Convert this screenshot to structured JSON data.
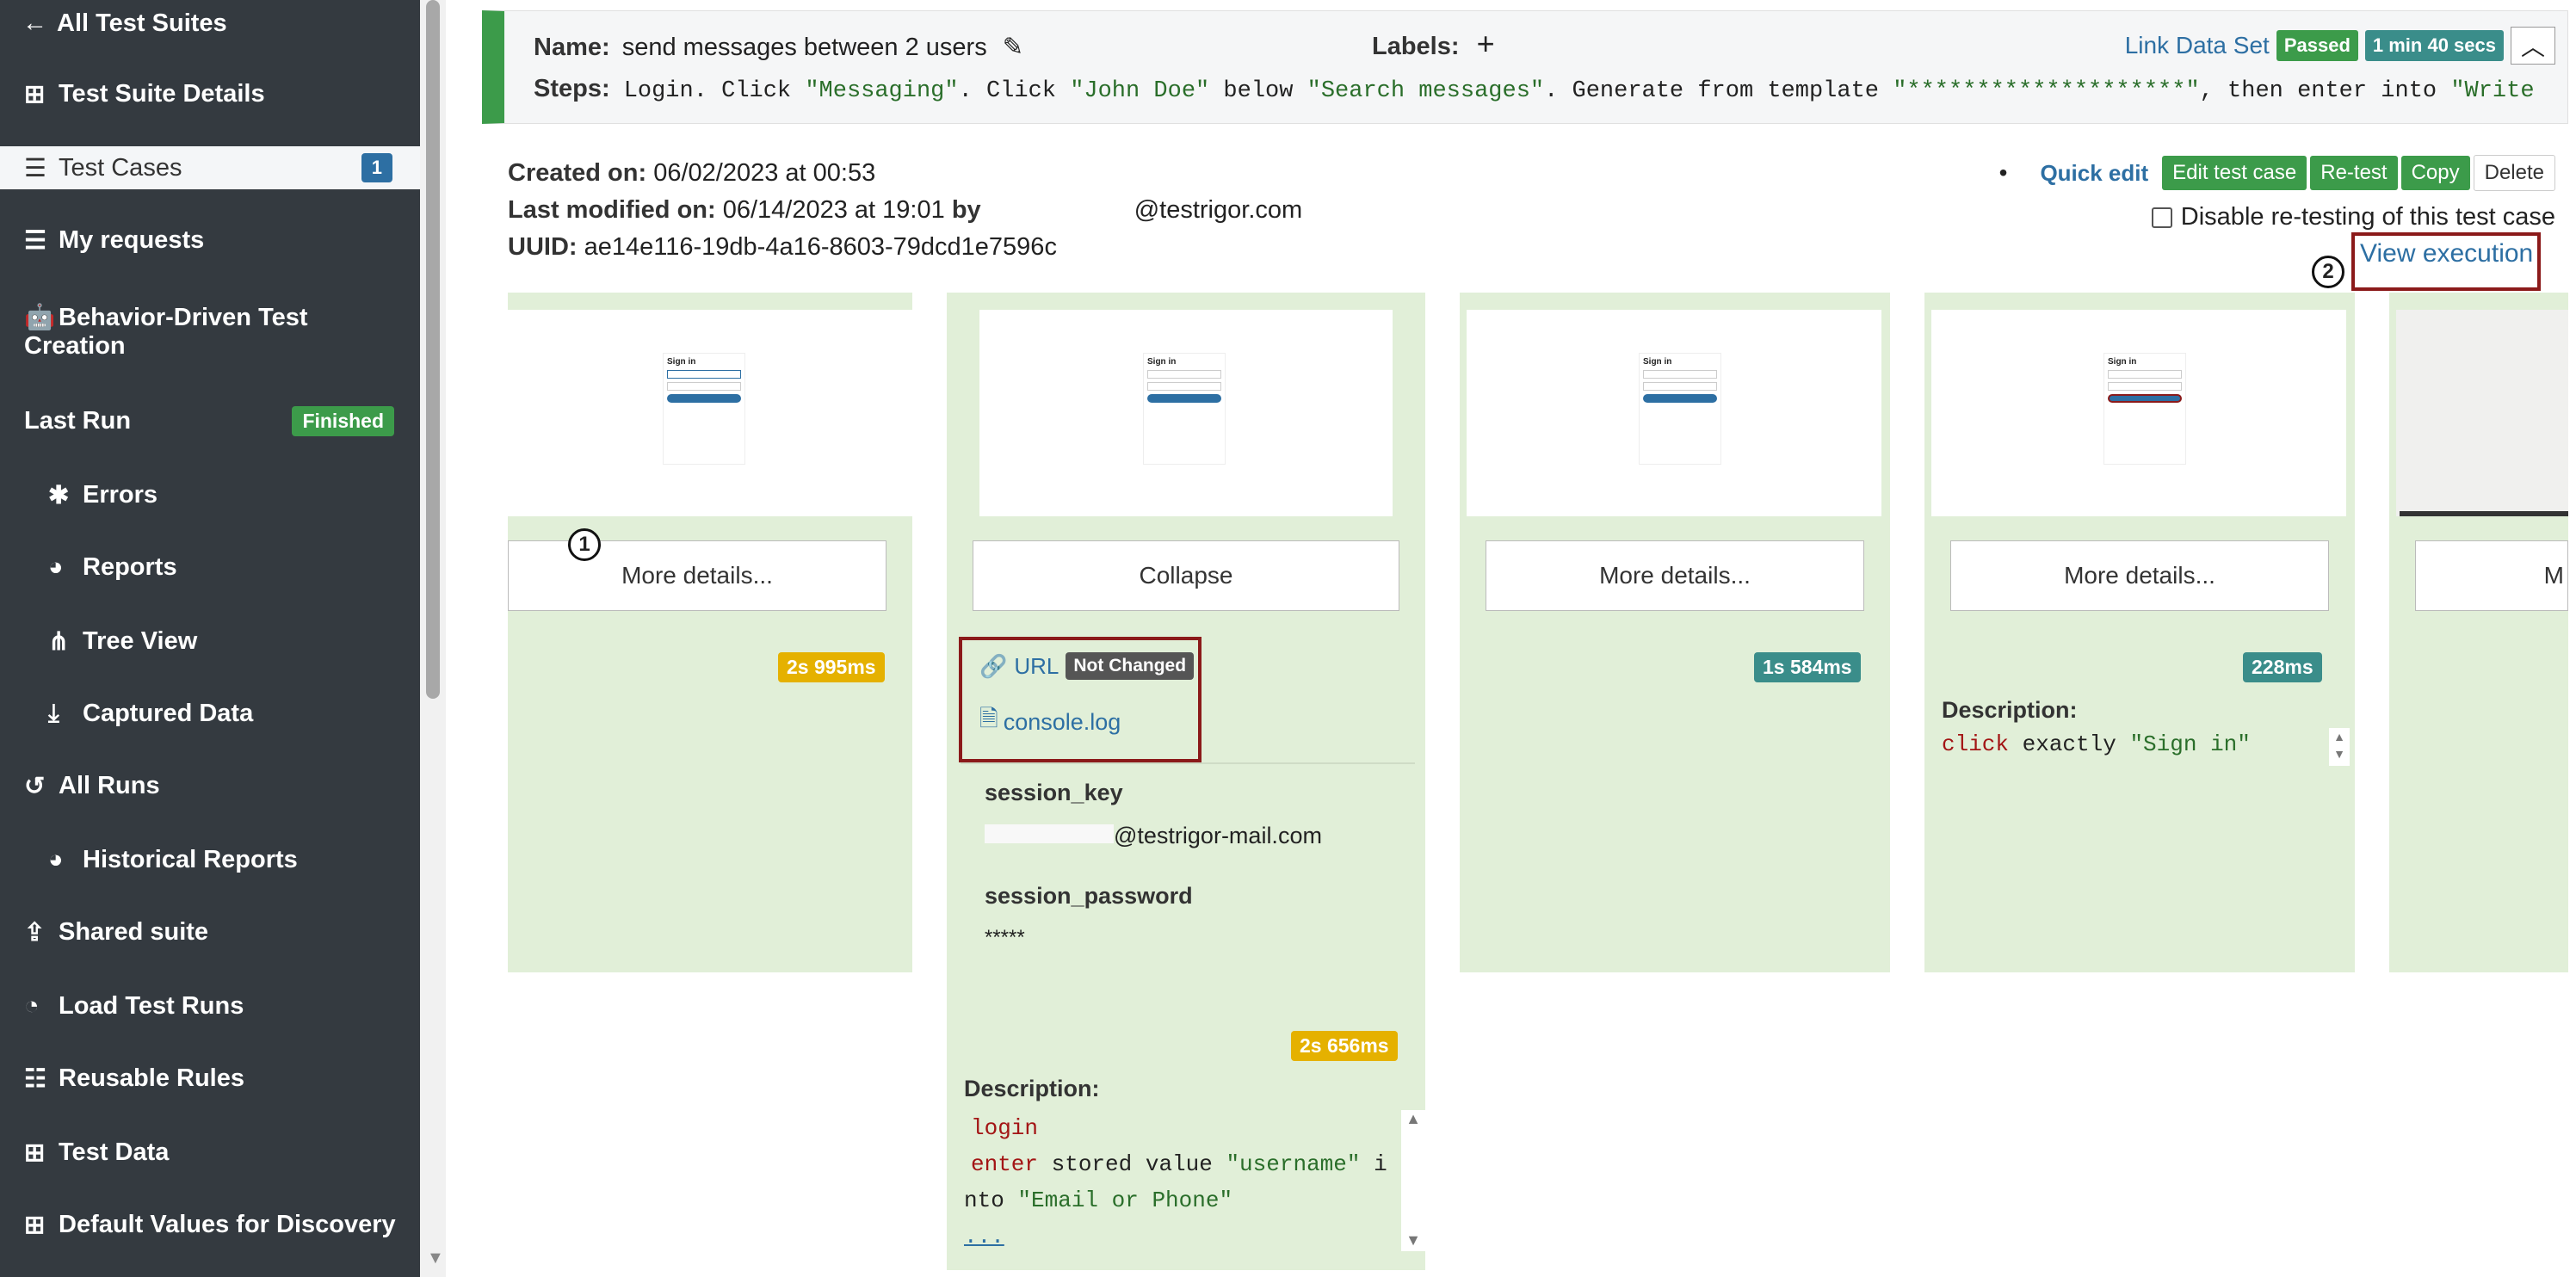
{
  "sidebar": {
    "back_label": "All Test Suites",
    "items": [
      {
        "label": "Test Suite Details",
        "icon": "table-icon"
      },
      {
        "label": "Test Cases",
        "icon": "list-icon",
        "badge": "1"
      },
      {
        "label": "My requests",
        "icon": "list-icon"
      },
      {
        "label": "Behavior-Driven Test",
        "label2": "Creation",
        "icon": "robot-icon"
      },
      {
        "label": "Last Run",
        "badge": "Finished"
      },
      {
        "label": "Errors",
        "icon": "bug-icon"
      },
      {
        "label": "Reports",
        "icon": "pie-icon"
      },
      {
        "label": "Tree View",
        "icon": "tree-icon"
      },
      {
        "label": "Captured Data",
        "icon": "download-icon"
      },
      {
        "label": "All Runs",
        "icon": "history-icon"
      },
      {
        "label": "Historical Reports",
        "icon": "pie-icon"
      },
      {
        "label": "Shared suite",
        "icon": "share-icon"
      },
      {
        "label": "Load Test Runs",
        "icon": "gauge-icon"
      },
      {
        "label": "Reusable Rules",
        "icon": "list-ol-icon"
      },
      {
        "label": "Test Data",
        "icon": "table-icon"
      },
      {
        "label": "Default Values for Discovery",
        "icon": "table-icon"
      }
    ]
  },
  "header": {
    "name_label": "Name:",
    "name_value": "send messages between 2 users",
    "labels_label": "Labels:",
    "steps_label": "Steps:",
    "steps_parts": {
      "p1": "Login. Click ",
      "s1": "\"Messaging\"",
      "p2": ". Click ",
      "s2": "\"John Doe\"",
      "p3": " below ",
      "s3": "\"Search messages\"",
      "p4": ". Generate from template ",
      "s4": "\"********************\"",
      "p5": ", then enter into ",
      "s5": "\"Write a mes…"
    },
    "link_data_set": "Link Data Set",
    "status": "Passed",
    "duration": "1 min 40 secs"
  },
  "info": {
    "created_label": "Created on:",
    "created_value": "06/02/2023 at 00:53",
    "modified_label": "Last modified on:",
    "modified_value": "06/14/2023 at 19:01",
    "by_label": "by",
    "by_value": "@testrigor.com",
    "uuid_label": "UUID:",
    "uuid_value": "ae14e116-19db-4a16-8603-79dcd1e7596c"
  },
  "actions": {
    "quick_edit": "Quick edit",
    "edit": "Edit test case",
    "retest": "Re-test",
    "copy": "Copy",
    "delete": "Delete",
    "disable_retest": "Disable re-testing of this test case",
    "view_execution": "View execution"
  },
  "cards": [
    {
      "button": "More details...",
      "time": "2s 995ms"
    },
    {
      "button": "Collapse",
      "time": "2s 656ms",
      "url_label": "URL",
      "url_badge": "Not Changed",
      "console": "console.log",
      "session_key_label": "session_key",
      "session_key_value": "@testrigor-mail.com",
      "session_password_label": "session_password",
      "session_password_value": "*****",
      "description_label": "Description:",
      "code": {
        "l1": "login",
        "l2a": "enter",
        "l2b": " stored value ",
        "l2c": "\"username\"",
        "l2d": " i",
        "l3a": "nto ",
        "l3b": "\"Email or Phone\"",
        "l4": "..."
      }
    },
    {
      "button": "More details...",
      "time": "1s 584ms"
    },
    {
      "button": "More details...",
      "time": "228ms",
      "description_label": "Description:",
      "code": {
        "a": "click",
        "b": " exactly ",
        "c": "\"Sign in\""
      }
    },
    {
      "button": "M"
    }
  ],
  "annotations": {
    "one": "1",
    "two": "2"
  },
  "thumbnail": {
    "title": "Sign in",
    "button": "Sign in"
  }
}
